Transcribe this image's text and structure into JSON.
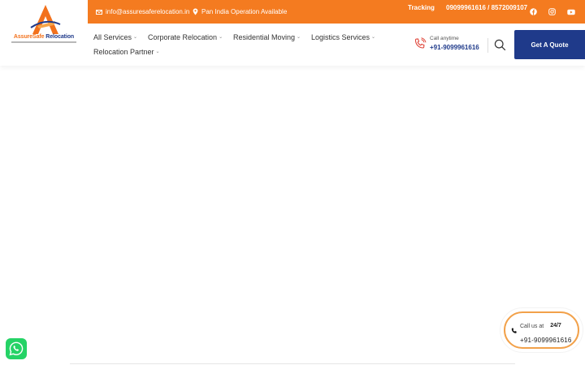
{
  "brand": {
    "name_part1": "AssureSafe",
    "name_part2": "Relocation",
    "accent_color": "#f47b20",
    "primary_color": "#1f3a8a"
  },
  "topbar": {
    "email": "info@assuresaferelocation.in",
    "operation": "Pan India Operation Available",
    "tracking_label": "Tracking",
    "phones": "09099961616 / 8572009107",
    "social_icons": [
      "facebook-icon",
      "instagram-icon",
      "youtube-icon"
    ]
  },
  "nav": {
    "items": [
      {
        "label": "All Services"
      },
      {
        "label": "Corporate Relocation"
      },
      {
        "label": "Residential Moving"
      },
      {
        "label": "Logistics Services"
      },
      {
        "label": "Relocation Partner"
      }
    ]
  },
  "call": {
    "label": "Call anytime",
    "number": "+91-9099961616"
  },
  "quote_button": "Get A Quote",
  "floating_call": {
    "label": "Call us at",
    "badge": "24/7",
    "number": "+91-9099961616"
  }
}
